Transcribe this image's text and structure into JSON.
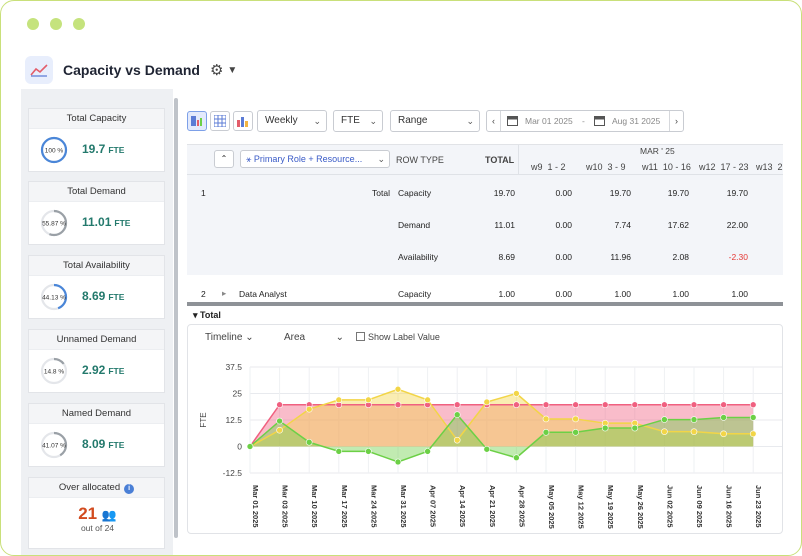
{
  "header": {
    "title": "Capacity vs Demand"
  },
  "metrics": [
    {
      "title": "Total Capacity",
      "pct_label": "100 %",
      "pct": 1.0,
      "value": "19.7",
      "unit": "FTE",
      "ring_color": "#4a86d8"
    },
    {
      "title": "Total Demand",
      "pct_label": "55.87 %",
      "pct": 0.5587,
      "value": "11.01",
      "unit": "FTE",
      "ring_color": "#9aa0a6"
    },
    {
      "title": "Total Availability",
      "pct_label": "44.13 %",
      "pct": 0.4413,
      "value": "8.69",
      "unit": "FTE",
      "ring_color": "#4a86d8"
    },
    {
      "title": "Unnamed Demand",
      "pct_label": "14.8 %",
      "pct": 0.148,
      "value": "2.92",
      "unit": "FTE",
      "ring_color": "#9aa0a6"
    },
    {
      "title": "Named Demand",
      "pct_label": "41.07 %",
      "pct": 0.4107,
      "value": "8.09",
      "unit": "FTE",
      "ring_color": "#9aa0a6"
    }
  ],
  "over": {
    "title": "Over allocated",
    "count": "21",
    "sub": "out of 24"
  },
  "toolbar": {
    "period": "Weekly",
    "unit": "FTE",
    "range": "Range",
    "start": "Mar 01 2025",
    "end": "Aug 31 2025",
    "sep": "-"
  },
  "grid": {
    "group_label": "Primary Role + Resource...",
    "row_type_header": "ROW TYPE",
    "total_header": "TOTAL",
    "month_header": "MAR ' 25",
    "weeks": [
      "w9  1 - 2",
      "w10  3 - 9",
      "w11  10 - 16",
      "w12  17 - 23",
      "w13  2"
    ],
    "rows": [
      {
        "idx": "1",
        "name": "",
        "group": "Total",
        "type": "Capacity",
        "total": "19.70",
        "vals": [
          "0.00",
          "19.70",
          "19.70",
          "19.70"
        ]
      },
      {
        "idx": "",
        "name": "",
        "group": "",
        "type": "Demand",
        "total": "11.01",
        "vals": [
          "0.00",
          "7.74",
          "17.62",
          "22.00"
        ]
      },
      {
        "idx": "",
        "name": "",
        "group": "",
        "type": "Availability",
        "total": "8.69",
        "vals": [
          "0.00",
          "11.96",
          "2.08",
          "-2.30"
        ]
      },
      {
        "idx": "2",
        "name": "Data Analyst",
        "group": "",
        "type": "Capacity",
        "total": "1.00",
        "vals": [
          "0.00",
          "1.00",
          "1.00",
          "1.00"
        ]
      }
    ]
  },
  "chart_panel": {
    "total_label": "Total",
    "view": "Timeline",
    "kind": "Area",
    "show_label": "Show Label Value"
  },
  "chart_data": {
    "type": "area",
    "ylabel": "FTE",
    "ylim": [
      -12.5,
      37.5
    ],
    "yticks": [
      "37.5",
      "25",
      "12.5",
      "0",
      "-12.5"
    ],
    "x": [
      "Mar 01 2025",
      "Mar 03 2025",
      "Mar 10 2025",
      "Mar 17 2025",
      "Mar 24 2025",
      "Mar 31 2025",
      "Apr 07 2025",
      "Apr 14 2025",
      "Apr 21 2025",
      "Apr 28 2025",
      "May 05 2025",
      "May 12 2025",
      "May 19 2025",
      "May 26 2025",
      "Jun 02 2025",
      "Jun 09 2025",
      "Jun 16 2025",
      "Jun 23 2025"
    ],
    "series": [
      {
        "name": "Capacity",
        "color": "#f06080",
        "values": [
          0,
          19.7,
          19.7,
          19.7,
          19.7,
          19.7,
          19.7,
          19.7,
          19.7,
          19.7,
          19.7,
          19.7,
          19.7,
          19.7,
          19.7,
          19.7,
          19.7,
          19.7
        ]
      },
      {
        "name": "Demand",
        "color": "#f2d547",
        "values": [
          0,
          7.7,
          17.6,
          22,
          22,
          27,
          22,
          3,
          21,
          25,
          13,
          13,
          11,
          11,
          7,
          7,
          6,
          6
        ]
      },
      {
        "name": "Availability",
        "color": "#6cd046",
        "values": [
          0,
          12,
          2,
          -2.3,
          -2.3,
          -7.3,
          -2.3,
          15,
          -1.3,
          -5.3,
          6.7,
          6.7,
          8.7,
          8.7,
          12.7,
          12.7,
          13.7,
          13.7
        ]
      }
    ]
  }
}
